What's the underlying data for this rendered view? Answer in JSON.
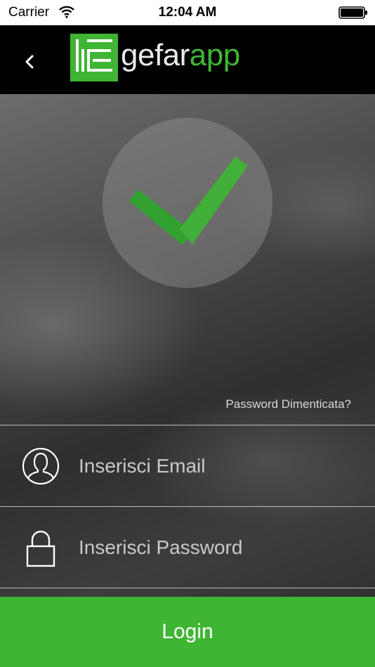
{
  "status_bar": {
    "carrier": "Carrier",
    "time": "12:04 AM",
    "icons": [
      "wifi-icon",
      "battery-icon"
    ]
  },
  "header": {
    "back_icon": "chevron-left-icon",
    "brand_prefix": "gefar",
    "brand_suffix": "app"
  },
  "hero": {
    "status_icon": "checkmark-icon"
  },
  "form": {
    "forgot_password": "Password Dimenticata?",
    "email": {
      "value": "",
      "placeholder": "Inserisci Email",
      "icon": "user-icon"
    },
    "password": {
      "value": "",
      "placeholder": "Inserisci Password",
      "icon": "lock-icon"
    },
    "login_label": "Login"
  },
  "colors": {
    "accent": "#3fb534",
    "header_bg": "#000000",
    "status_bg": "#ffffff",
    "placeholder": "#c9c9c9"
  }
}
